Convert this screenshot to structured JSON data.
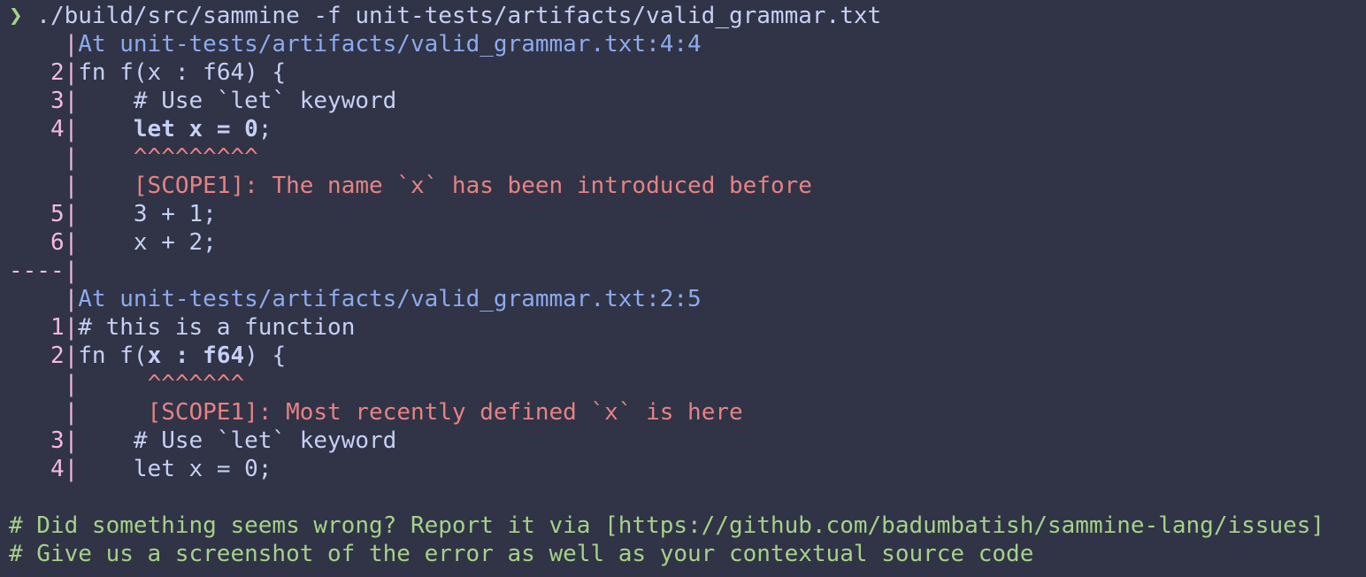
{
  "colors": {
    "background": "#303446",
    "text": "#c6d0f5",
    "prompt": "#a6d189",
    "line_number": "#f4b8e4",
    "location": "#8caaee",
    "error": "#e78284",
    "footer": "#a6d189"
  },
  "command": {
    "prompt_icon": "chevron-right-icon",
    "prompt": "❯",
    "text": " ./build/src/sammine -f unit-tests/artifacts/valid_grammar.txt"
  },
  "block1": {
    "location": "At unit-tests/artifacts/valid_grammar.txt:4:4",
    "line2_no": "   2",
    "line2_code": "fn f(x : f64) {",
    "line3_no": "   3",
    "line3_code": "    # Use `let` keyword",
    "line4_no": "   4",
    "line4_indent": "    ",
    "line4_code_bold": "let x = 0",
    "line4_code_tail": ";",
    "carets_indent": "    ",
    "carets": "^^^^^^^^^",
    "message_indent": "    ",
    "message": "[SCOPE1]: The name `x` has been introduced before",
    "line5_no": "   5",
    "line5_code": "    3 + 1;",
    "line6_no": "   6",
    "line6_code": "    x + 2;"
  },
  "separator": "----",
  "block2": {
    "location": "At unit-tests/artifacts/valid_grammar.txt:2:5",
    "line1_no": "   1",
    "line1_code": "# this is a function",
    "line2_no": "   2",
    "line2_code_head": "fn f(",
    "line2_code_bold": "x : f64",
    "line2_code_tail": ") {",
    "carets_indent": "     ",
    "carets": "^^^^^^^",
    "message_indent": "     ",
    "message": "[SCOPE1]: Most recently defined `x` is here",
    "line3_no": "   3",
    "line3_code": "    # Use `let` keyword",
    "line4_no": "   4",
    "line4_code": "    let x = 0;"
  },
  "footer": {
    "line1": "# Did something seems wrong? Report it via [https://github.com/badumbatish/sammine-lang/issues]",
    "line2": "# Give us a screenshot of the error as well as your contextual source code"
  },
  "gutter": {
    "bar": "|",
    "blank": "    "
  }
}
